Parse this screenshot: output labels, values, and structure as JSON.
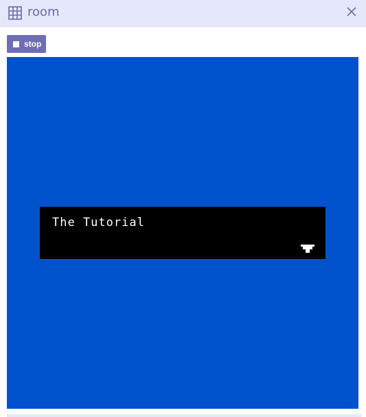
{
  "window": {
    "title": "room",
    "icon": "grid-icon",
    "close_icon": "close-icon"
  },
  "toolbar": {
    "stop_label": "stop",
    "stop_icon": "stop-square-icon"
  },
  "game": {
    "background_color": "#0052cc",
    "dialog": {
      "text": "The Tutorial",
      "continue_icon": "down-arrow-icon"
    }
  },
  "colors": {
    "titlebar": "#e5e8fa",
    "accent": "#6e6db6",
    "dialog_bg": "#000000",
    "dialog_text": "#ffffff"
  }
}
